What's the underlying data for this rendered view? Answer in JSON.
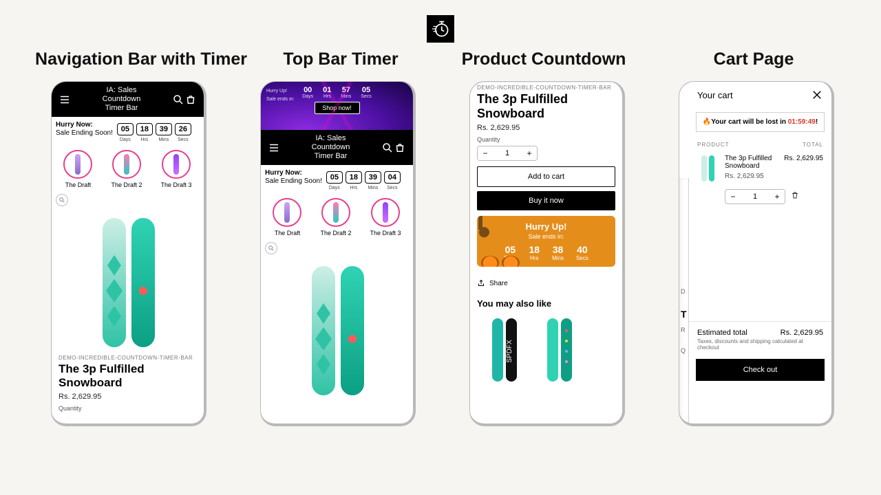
{
  "headings": {
    "c1": "Navigation Bar with Timer",
    "c2": "Top Bar  Timer",
    "c3": "Product Countdown",
    "c4": "Cart Page"
  },
  "header": {
    "title_line1": "IA: Sales",
    "title_line2": "Countdown",
    "title_line3": "Timer Bar"
  },
  "hurry": {
    "bold": "Hurry Now:",
    "sub": "Sale Ending Soon!",
    "labels": {
      "d": "Days",
      "h": "Hrs",
      "m": "Mins",
      "s": "Secs"
    }
  },
  "timers": {
    "p1": [
      "05",
      "18",
      "39",
      "26"
    ],
    "p2_top": [
      "00",
      "01",
      "57",
      "05"
    ],
    "p2_bar": [
      "05",
      "18",
      "39",
      "04"
    ],
    "p3": [
      "05",
      "18",
      "38",
      "40"
    ]
  },
  "topbar": {
    "hurry": "Hurry Up!",
    "sub": "Sale ends in:",
    "shop": "Shop now!"
  },
  "drafts": [
    "The Draft",
    "The Draft 2",
    "The Draft 3"
  ],
  "product": {
    "eyebrow": "DEMO-INCREDIBLE-COUNTDOWN-TIMER-BAR",
    "title": "The 3p Fulfilled Snowboard",
    "price": "Rs. 2,629.95",
    "qty_label": "Quantity",
    "qty_value": "1",
    "add": "Add to cart",
    "buy": "Buy it now",
    "share": "Share",
    "also": "You may also like"
  },
  "orange": {
    "title": "Hurry Up!",
    "sub": "Sale ends in:"
  },
  "cart": {
    "title": "Your cart",
    "alert_pre": "🔥Your cart will be lost in ",
    "alert_time": "01:59:49",
    "alert_post": "!",
    "col_product": "PRODUCT",
    "col_total": "TOTAL",
    "item_title": "The 3p Fulfilled Snowboard",
    "item_price": "Rs. 2,629.95",
    "line_total": "Rs. 2,629.95",
    "qty": "1",
    "estimated_label": "Estimated total",
    "estimated_value": "Rs. 2,629.95",
    "tax_note": "Taxes, discounts and shipping calculated at checkout",
    "checkout": "Check out",
    "behind_d": "D",
    "behind_t": "T",
    "behind_r": "R",
    "behind_q": "Q"
  }
}
